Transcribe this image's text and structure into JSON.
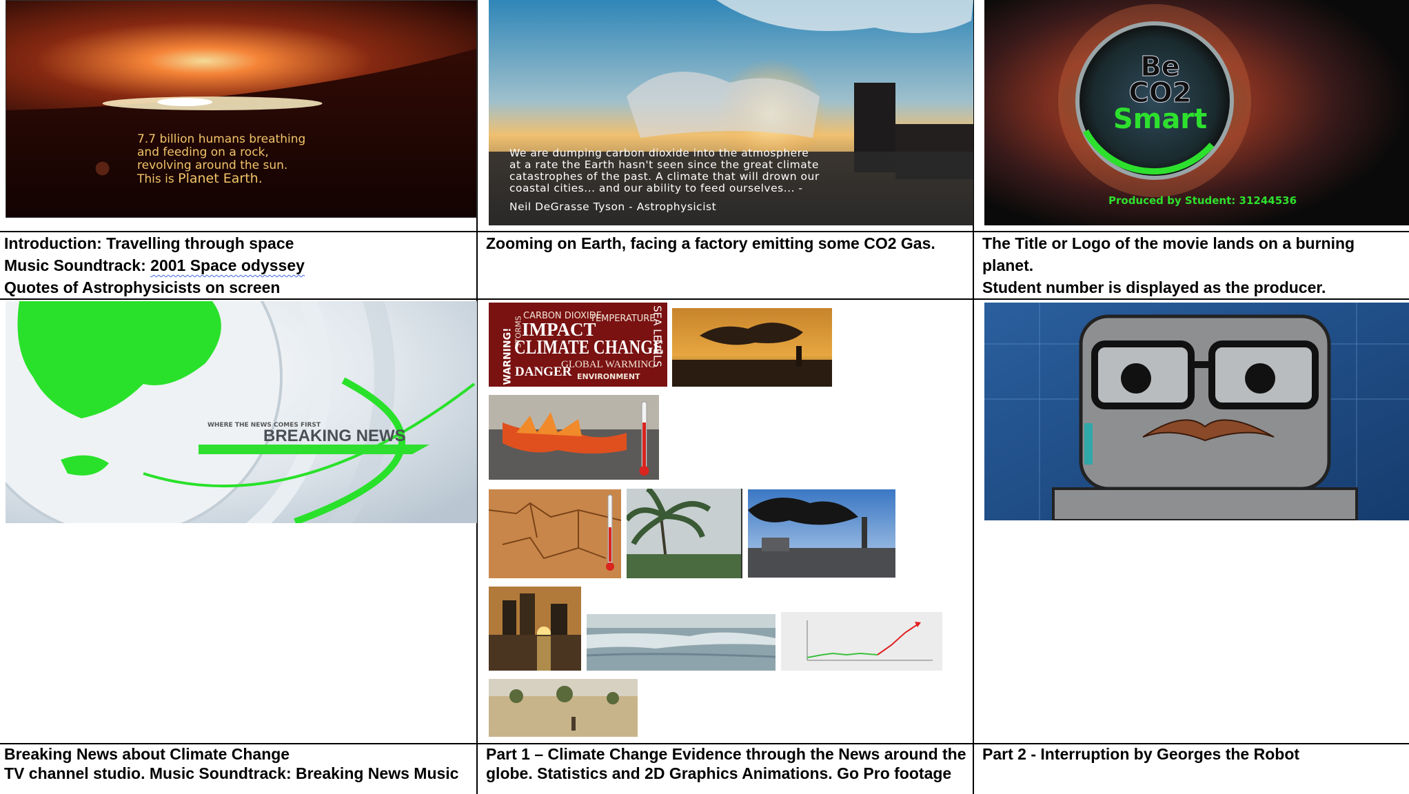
{
  "frames": {
    "intro": {
      "overlay_lines": [
        "7.7 billion humans breathing",
        "and feeding on a rock,",
        "revolving around the sun."
      ],
      "overlay_last_prefix": "This is ",
      "overlay_last_emph": "Planet Earth."
    },
    "factory": {
      "quote_lines": [
        "We are dumping carbon dioxide into the atmosphere",
        "at a rate the Earth hasn't seen since the great climate",
        "catastrophes of the past. A climate that will drown our",
        "coastal cities... and our ability to feed ourselves... -"
      ],
      "quote_author": "Neil DeGrasse Tyson - Astrophysicist"
    },
    "logo": {
      "logo_lines": [
        "Be",
        "CO2",
        "Smart"
      ],
      "producer_text": "Produced by Student: 31244536"
    },
    "news": {
      "small_text": "WHERE THE NEWS COMES FIRST",
      "big_text": "BREAKING NEWS"
    },
    "wordcloud": {
      "words": [
        "CARBON DIOXIDE",
        "IMPACT",
        "TEMPERATURE",
        "CLIMATE CHANGE",
        "GLOBAL WARMING",
        "DANGER",
        "ENVIRONMENT",
        "WARNING!",
        "STORMS",
        "SEA LEVELS"
      ]
    }
  },
  "captions": {
    "row1": {
      "col1": {
        "line1": "Introduction: Travelling through space",
        "line2_prefix": "Music Soundtrack: ",
        "line2_link": "2001 Space odyssey",
        "line3": "Quotes of Astrophysicists on screen"
      },
      "col2": {
        "line1": "Zooming on Earth, facing a factory emitting some CO2 Gas."
      },
      "col3": {
        "line1": "The Title or Logo of the movie lands on a burning",
        "line2": "planet.",
        "line3": "Student number is displayed as the producer."
      }
    },
    "row2": {
      "col1": {
        "line1": "Breaking News about Climate Change",
        "line2": "TV channel studio. Music Soundtrack: Breaking News Music"
      },
      "col2": {
        "line1": "Part 1 – Climate Change Evidence through the News around the",
        "line2": "globe. Statistics and 2D Graphics Animations. Go Pro footage"
      },
      "col3": {
        "line1": "Part 2 - Interruption by Georges the Robot"
      }
    }
  }
}
